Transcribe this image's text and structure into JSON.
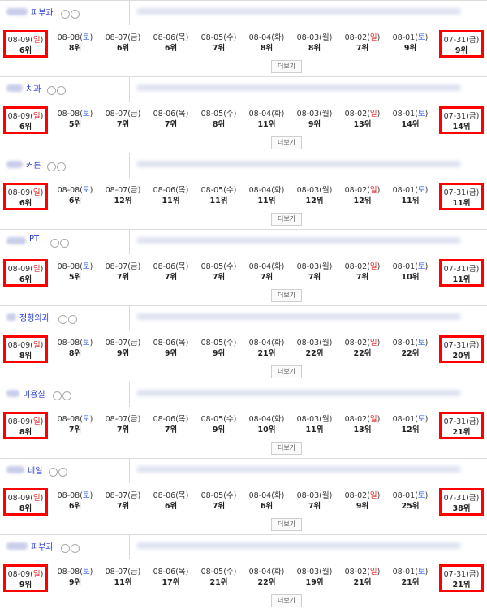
{
  "keywords": [
    {
      "name": "피부과",
      "blur_width": 26
    },
    {
      "name": "치과",
      "blur_width": 20
    },
    {
      "name": "커튼",
      "blur_width": 20
    },
    {
      "name": "PT",
      "blur_width": 24
    },
    {
      "name": "정형외과",
      "blur_width": 12
    },
    {
      "name": "미용실",
      "blur_width": 16
    },
    {
      "name": "네일",
      "blur_width": 22
    },
    {
      "name": "피부과",
      "blur_width": 26
    }
  ],
  "dates": [
    {
      "date": "08-09(",
      "day": "일",
      "type": "sun"
    },
    {
      "date": "08-08(",
      "day": "토",
      "type": "sat"
    },
    {
      "date": "08-07(",
      "day": "금",
      "type": "week"
    },
    {
      "date": "08-06(",
      "day": "목",
      "type": "week"
    },
    {
      "date": "08-05(",
      "day": "수",
      "type": "week"
    },
    {
      "date": "08-04(",
      "day": "화",
      "type": "week"
    },
    {
      "date": "08-03(",
      "day": "월",
      "type": "week"
    },
    {
      "date": "08-02(",
      "day": "일",
      "type": "sun"
    },
    {
      "date": "08-01(",
      "day": "토",
      "type": "sat"
    },
    {
      "date": "07-31(",
      "day": "금",
      "type": "week"
    }
  ],
  "close_paren": ")",
  "more_label": "더보기",
  "highlight_color": "#ff0000",
  "ranks": [
    [
      "6위",
      "8위",
      "6위",
      "6위",
      "7위",
      "8위",
      "8위",
      "7위",
      "9위",
      "9위"
    ],
    [
      "6위",
      "5위",
      "7위",
      "7위",
      "8위",
      "11위",
      "9위",
      "13위",
      "14위",
      "14위"
    ],
    [
      "6위",
      "6위",
      "12위",
      "11위",
      "11위",
      "11위",
      "12위",
      "12위",
      "11위",
      "11위"
    ],
    [
      "6위",
      "5위",
      "7위",
      "7위",
      "7위",
      "7위",
      "7위",
      "7위",
      "10위",
      "11위"
    ],
    [
      "8위",
      "8위",
      "9위",
      "9위",
      "9위",
      "21위",
      "22위",
      "22위",
      "22위",
      "20위"
    ],
    [
      "8위",
      "7위",
      "7위",
      "7위",
      "9위",
      "10위",
      "11위",
      "13위",
      "12위",
      "21위"
    ],
    [
      "8위",
      "6위",
      "7위",
      "6위",
      "7위",
      "6위",
      "7위",
      "9위",
      "25위",
      "38위"
    ],
    [
      "9위",
      "9위",
      "11위",
      "17위",
      "21위",
      "22위",
      "19위",
      "21위",
      "21위",
      "21위"
    ]
  ]
}
